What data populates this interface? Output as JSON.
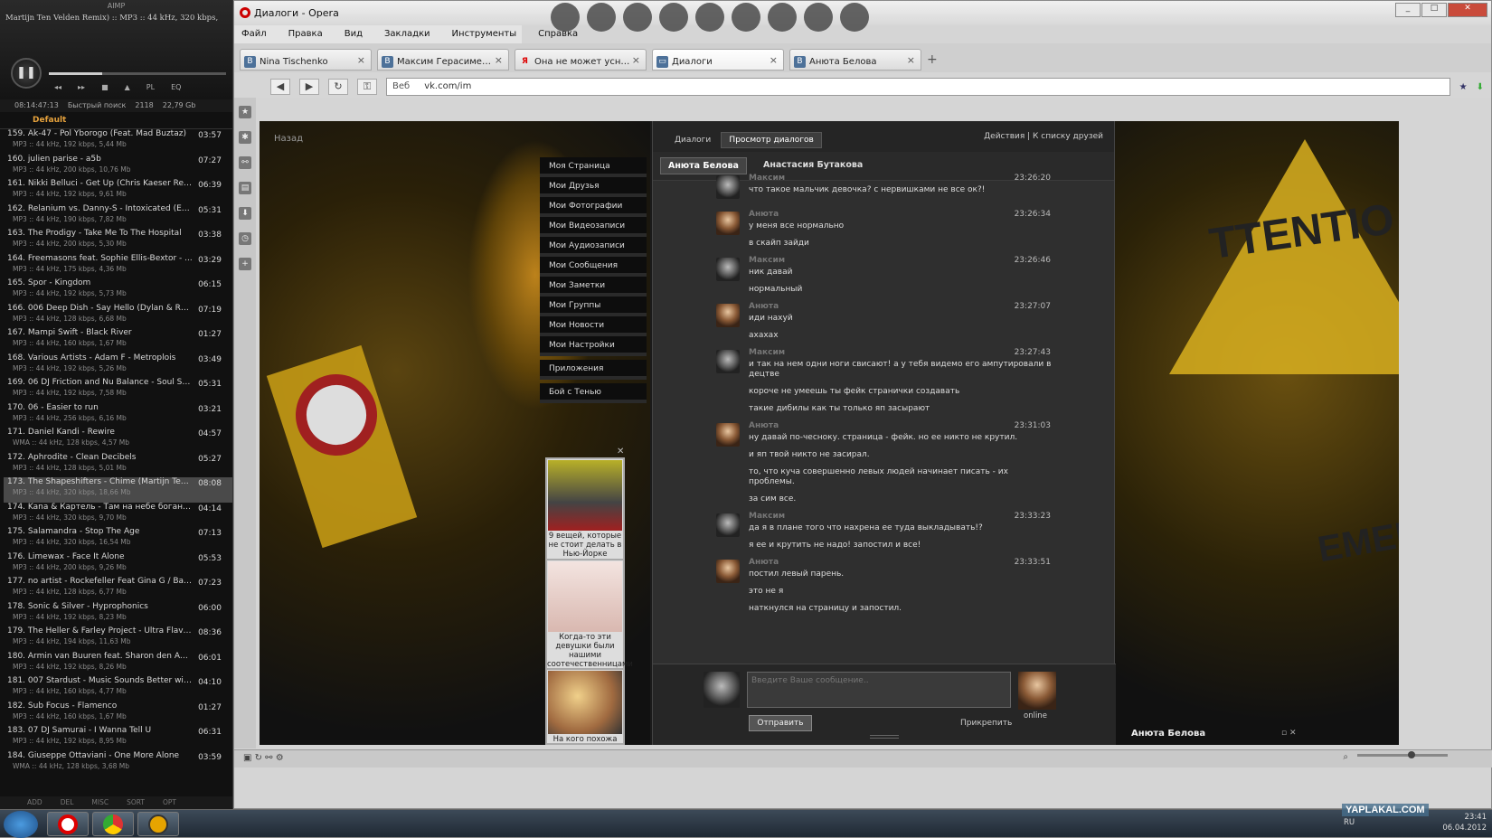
{
  "aimp": {
    "title": "AIMP",
    "track": "Martijn Ten Velden Remix) :: MP3 :: 44 kHz, 320 kbps,",
    "play_icon": "pause-icon",
    "status": {
      "time": "08:14:47:13",
      "search": "Быстрый поиск",
      "count": "2118",
      "size": "22,79 Gb"
    },
    "controls": [
      "PL",
      "EQ"
    ],
    "playlist_name": "Default",
    "items": [
      {
        "title": "159. Ak-47 - Pol Yborogo (Feat. Mad Buztaz)",
        "dur": "03:57",
        "meta": "MP3 :: 44 kHz, 192 kbps, 5,44 Mb"
      },
      {
        "title": "160. julien parise - a5b",
        "dur": "07:27",
        "meta": "MP3 :: 44 kHz, 200 kbps, 10,76 Mb"
      },
      {
        "title": "161. Nikki Belluci - Get Up (Chris Kaeser Remix)",
        "dur": "06:39",
        "meta": "MP3 :: 44 kHz, 192 kbps, 9,61 Mb"
      },
      {
        "title": "162. Relanium vs. Danny-S - Intoxicated (Ex...",
        "dur": "05:31",
        "meta": "MP3 :: 44 kHz, 190 kbps, 7,82 Mb"
      },
      {
        "title": "163. The Prodigy - Take Me To The Hospital",
        "dur": "03:38",
        "meta": "MP3 :: 44 kHz, 200 kbps, 5,30 Mb"
      },
      {
        "title": "164. Freemasons feat. Sophie Ellis-Bextor - ...",
        "dur": "03:29",
        "meta": "MP3 :: 44 kHz, 175 kbps, 4,36 Mb"
      },
      {
        "title": "165. Spor - Kingdom",
        "dur": "06:15",
        "meta": "MP3 :: 44 kHz, 192 kbps, 5,73 Mb"
      },
      {
        "title": "166. 006 Deep Dish - Say Hello (Dylan & Rhy...",
        "dur": "07:19",
        "meta": "MP3 :: 44 kHz, 128 kbps, 6,68 Mb"
      },
      {
        "title": "167. Mampi Swift - Black River",
        "dur": "01:27",
        "meta": "MP3 :: 44 kHz, 160 kbps, 1,67 Mb"
      },
      {
        "title": "168. Various Artists - Adam F - Metroplois",
        "dur": "03:49",
        "meta": "MP3 :: 44 kHz, 192 kbps, 5,26 Mb"
      },
      {
        "title": "169. 06 DJ Friction and Nu Balance - Soul Su...",
        "dur": "05:31",
        "meta": "MP3 :: 44 kHz, 192 kbps, 7,58 Mb"
      },
      {
        "title": "170. 06 - Easier to run",
        "dur": "03:21",
        "meta": "MP3 :: 44 kHz, 256 kbps, 6,16 Mb"
      },
      {
        "title": "171. Daniel Kandi - Rewire",
        "dur": "04:57",
        "meta": "WMA :: 44 kHz, 128 kbps, 4,57 Mb"
      },
      {
        "title": "172. Aphrodite - Clean Decibels",
        "dur": "05:27",
        "meta": "MP3 :: 44 kHz, 128 kbps, 5,01 Mb"
      },
      {
        "title": "173. The Shapeshifters - Chime (Martijn Ten ...",
        "dur": "08:08",
        "meta": "MP3 :: 44 kHz, 320 kbps, 18,66 Mb"
      },
      {
        "title": "174. Kana & Картель - Там на небе боган #2",
        "dur": "04:14",
        "meta": "MP3 :: 44 kHz, 320 kbps, 9,70 Mb"
      },
      {
        "title": "175. Salamandra - Stop The Age",
        "dur": "07:13",
        "meta": "MP3 :: 44 kHz, 320 kbps, 16,54 Mb"
      },
      {
        "title": "176. Limewax - Face It Alone",
        "dur": "05:53",
        "meta": "MP3 :: 44 kHz, 200 kbps, 9,26 Mb"
      },
      {
        "title": "177. no artist - Rockefeller Feat Gina G / Bac...",
        "dur": "07:23",
        "meta": "MP3 :: 44 kHz, 128 kbps, 6,77 Mb"
      },
      {
        "title": "178. Sonic & Silver - Hyprophonics",
        "dur": "06:00",
        "meta": "MP3 :: 44 kHz, 192 kbps, 8,23 Mb"
      },
      {
        "title": "179. The Heller & Farley Project - Ultra Flava...",
        "dur": "08:36",
        "meta": "MP3 :: 44 kHz, 194 kbps, 11,63 Mb"
      },
      {
        "title": "180. Armin van Buuren feat. Sharon den Ade...",
        "dur": "06:01",
        "meta": "MP3 :: 44 kHz, 192 kbps, 8,26 Mb"
      },
      {
        "title": "181. 007 Stardust - Music Sounds Better with...",
        "dur": "04:10",
        "meta": "MP3 :: 44 kHz, 160 kbps, 4,77 Mb"
      },
      {
        "title": "182. Sub Focus - Flamenco",
        "dur": "01:27",
        "meta": "MP3 :: 44 kHz, 160 kbps, 1,67 Mb"
      },
      {
        "title": "183. 07 DJ Samurai - I Wanna Tell U",
        "dur": "06:31",
        "meta": "MP3 :: 44 kHz, 192 kbps, 8,95 Mb"
      },
      {
        "title": "184. Giuseppe Ottaviani - One More Alone",
        "dur": "03:59",
        "meta": "WMA :: 44 kHz, 128 kbps, 3,68 Mb"
      }
    ],
    "bottom": [
      "ADD",
      "DEL",
      "MISC",
      "SORT",
      "OPT"
    ]
  },
  "opera": {
    "title": "Диалоги - Opera",
    "menu": [
      "Файл",
      "Правка",
      "Вид",
      "Закладки",
      "Инструменты",
      "Справка"
    ],
    "tabs": [
      {
        "label": "Nina Tischenko",
        "fav": "В"
      },
      {
        "label": "Максим Герасименко",
        "fav": "В"
      },
      {
        "label": "Она не может уснуть...",
        "fav": "Я"
      },
      {
        "label": "Диалоги",
        "fav": "💬"
      },
      {
        "label": "Анюта Белова",
        "fav": "В"
      }
    ],
    "address": {
      "web": "Веб",
      "url": "vk.com/im"
    }
  },
  "vk": {
    "back": "Назад",
    "menu": [
      "Моя Страница",
      "Мои Друзья",
      "Мои Фотографии",
      "Мои Видеозаписи",
      "Мои Аудиозаписи",
      "Мои Сообщения",
      "Мои Заметки",
      "Мои Группы",
      "Мои Новости",
      "Мои Настройки",
      "Приложения",
      "Бой с Тенью"
    ],
    "promos": [
      "9 вещей, которые не стоит делать в Нью-Йорке",
      "Когда-то эти девушки были нашими соотечественницами",
      "На кого похожа"
    ],
    "chat_tabs": [
      "Диалоги",
      "Просмотр диалогов"
    ],
    "actions": "Действия | К списку друзей",
    "peers": [
      "Анюта Белова",
      "Анастасия Бутакова"
    ],
    "messages": [
      {
        "who": "Максим",
        "time": "23:26:20",
        "av": "cat",
        "lines": [
          "что такое мальчик девочка? с нервишками не все ок?!"
        ]
      },
      {
        "who": "Анюта",
        "time": "23:26:34",
        "av": "girl",
        "lines": [
          "у меня все нормально",
          "в скайп зайди"
        ]
      },
      {
        "who": "Максим",
        "time": "23:26:46",
        "av": "cat",
        "lines": [
          "ник давай",
          "нормальный"
        ]
      },
      {
        "who": "Анюта",
        "time": "23:27:07",
        "av": "girl",
        "lines": [
          "иди нахуй",
          "ахахах"
        ]
      },
      {
        "who": "Максим",
        "time": "23:27:43",
        "av": "cat",
        "lines": [
          "и так на нем одни ноги свисают! а у тебя видемо его ампутировали в децтве",
          "короче не умеешь ты фейк странички создавать",
          "такие дибилы как ты только яп засырают"
        ]
      },
      {
        "who": "Анюта",
        "time": "23:31:03",
        "av": "girl",
        "lines": [
          "ну давай по-чесноку. страница - фейк. но ее никто не крутил.",
          "и яп твой никто не засирал.",
          "то, что куча совершенно левых людей начинает писать - их проблемы.",
          "за сим все."
        ]
      },
      {
        "who": "Максим",
        "time": "23:33:23",
        "av": "cat",
        "lines": [
          "да я в плане того что нахрена ее туда выкладывать!?",
          "я ее и крутить не надо! запостил и все!"
        ]
      },
      {
        "who": "Анюта",
        "time": "23:33:51",
        "av": "girl",
        "lines": [
          "постил левый парень.",
          "это не я",
          "наткнулся на страницу и запостил."
        ]
      }
    ],
    "compose": {
      "placeholder": "Введите Ваше сообщение..",
      "send": "Отправить",
      "attach": "Прикрепить",
      "online": "online"
    },
    "bottom_name": "Анюта Белова"
  },
  "taskbar": {
    "lang": "RU",
    "time": "23:41",
    "date": "06.04.2012",
    "watermark": "YAPLAKAL.COM"
  }
}
